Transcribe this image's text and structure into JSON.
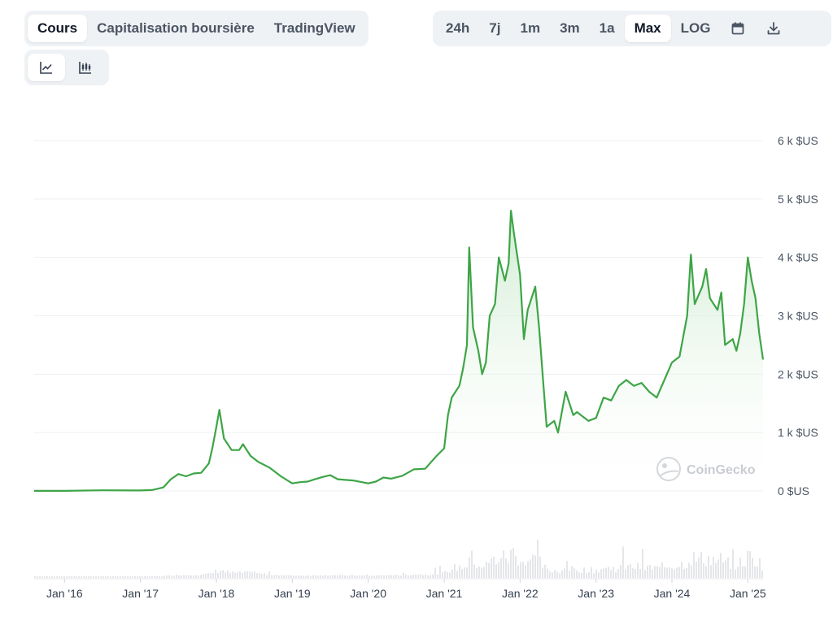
{
  "tabs": [
    {
      "label": "Cours",
      "active": true
    },
    {
      "label": "Capitalisation boursière",
      "active": false
    },
    {
      "label": "TradingView",
      "active": false
    }
  ],
  "ranges": [
    {
      "label": "24h",
      "active": false
    },
    {
      "label": "7j",
      "active": false
    },
    {
      "label": "1m",
      "active": false
    },
    {
      "label": "3m",
      "active": false
    },
    {
      "label": "1a",
      "active": false
    },
    {
      "label": "Max",
      "active": true
    },
    {
      "label": "LOG",
      "active": false
    }
  ],
  "icons": {
    "calendar": "calendar-icon",
    "download": "download-icon",
    "line_chart": "line-chart-icon",
    "candlestick": "candlestick-icon"
  },
  "watermark": "CoinGecko",
  "colors": {
    "line": "#3ea546",
    "fill_top": "#c6e8c9",
    "grid": "#eceff2",
    "volume": "#e4e6e9"
  },
  "chart_data": {
    "type": "area",
    "title": "",
    "xlabel": "",
    "ylabel": "",
    "y_unit": "$US",
    "ylim": [
      0,
      6000
    ],
    "yticks": [
      0,
      1000,
      2000,
      3000,
      4000,
      5000,
      6000
    ],
    "ytick_labels": [
      "0 $US",
      "1 k $US",
      "2 k $US",
      "3 k $US",
      "4 k $US",
      "5 k $US",
      "6 k $US"
    ],
    "xlim": [
      2015.6,
      2025.2
    ],
    "xticks": [
      2016,
      2017,
      2018,
      2019,
      2020,
      2021,
      2022,
      2023,
      2024,
      2025
    ],
    "xtick_labels": [
      "Jan '16",
      "Jan '17",
      "Jan '18",
      "Jan '19",
      "Jan '20",
      "Jan '21",
      "Jan '22",
      "Jan '23",
      "Jan '24",
      "Jan '25"
    ],
    "grid": true,
    "series": [
      {
        "x": [
          2015.6,
          2016.0,
          2016.5,
          2016.9,
          2017.0,
          2017.15,
          2017.3,
          2017.4,
          2017.5,
          2017.6,
          2017.7,
          2017.8,
          2017.9,
          2017.95,
          2018.0,
          2018.04,
          2018.1,
          2018.2,
          2018.3,
          2018.35,
          2018.45,
          2018.55,
          2018.7,
          2018.85,
          2019.0,
          2019.1,
          2019.2,
          2019.3,
          2019.4,
          2019.5,
          2019.6,
          2019.8,
          2020.0,
          2020.1,
          2020.2,
          2020.3,
          2020.45,
          2020.6,
          2020.75,
          2020.9,
          2021.0,
          2021.05,
          2021.1,
          2021.2,
          2021.25,
          2021.3,
          2021.33,
          2021.38,
          2021.45,
          2021.5,
          2021.55,
          2021.6,
          2021.67,
          2021.72,
          2021.8,
          2021.85,
          2021.88,
          2021.92,
          2022.0,
          2022.05,
          2022.1,
          2022.2,
          2022.25,
          2022.3,
          2022.35,
          2022.45,
          2022.5,
          2022.6,
          2022.7,
          2022.75,
          2022.9,
          2023.0,
          2023.1,
          2023.2,
          2023.3,
          2023.4,
          2023.5,
          2023.6,
          2023.7,
          2023.8,
          2023.9,
          2024.0,
          2024.1,
          2024.2,
          2024.25,
          2024.3,
          2024.4,
          2024.45,
          2024.5,
          2024.6,
          2024.65,
          2024.7,
          2024.8,
          2024.85,
          2024.9,
          2024.95,
          2025.0,
          2025.05,
          2025.1,
          2025.15,
          2025.2
        ],
        "y": [
          1,
          2,
          11,
          9,
          8,
          15,
          60,
          200,
          290,
          250,
          300,
          310,
          470,
          750,
          1100,
          1390,
          900,
          700,
          700,
          800,
          600,
          500,
          400,
          250,
          130,
          150,
          160,
          200,
          240,
          270,
          200,
          180,
          130,
          160,
          230,
          210,
          260,
          370,
          380,
          600,
          730,
          1300,
          1600,
          1800,
          2100,
          2500,
          4170,
          2800,
          2400,
          2000,
          2200,
          3000,
          3200,
          4000,
          3600,
          3900,
          4800,
          4400,
          3700,
          2600,
          3100,
          3500,
          2800,
          1950,
          1100,
          1200,
          1000,
          1700,
          1300,
          1350,
          1200,
          1250,
          1600,
          1550,
          1800,
          1900,
          1800,
          1850,
          1700,
          1600,
          1900,
          2200,
          2300,
          3000,
          4050,
          3200,
          3500,
          3800,
          3300,
          3100,
          3400,
          2500,
          2600,
          2400,
          2700,
          3200,
          4000,
          3600,
          3300,
          2700,
          2250
        ]
      }
    ]
  }
}
